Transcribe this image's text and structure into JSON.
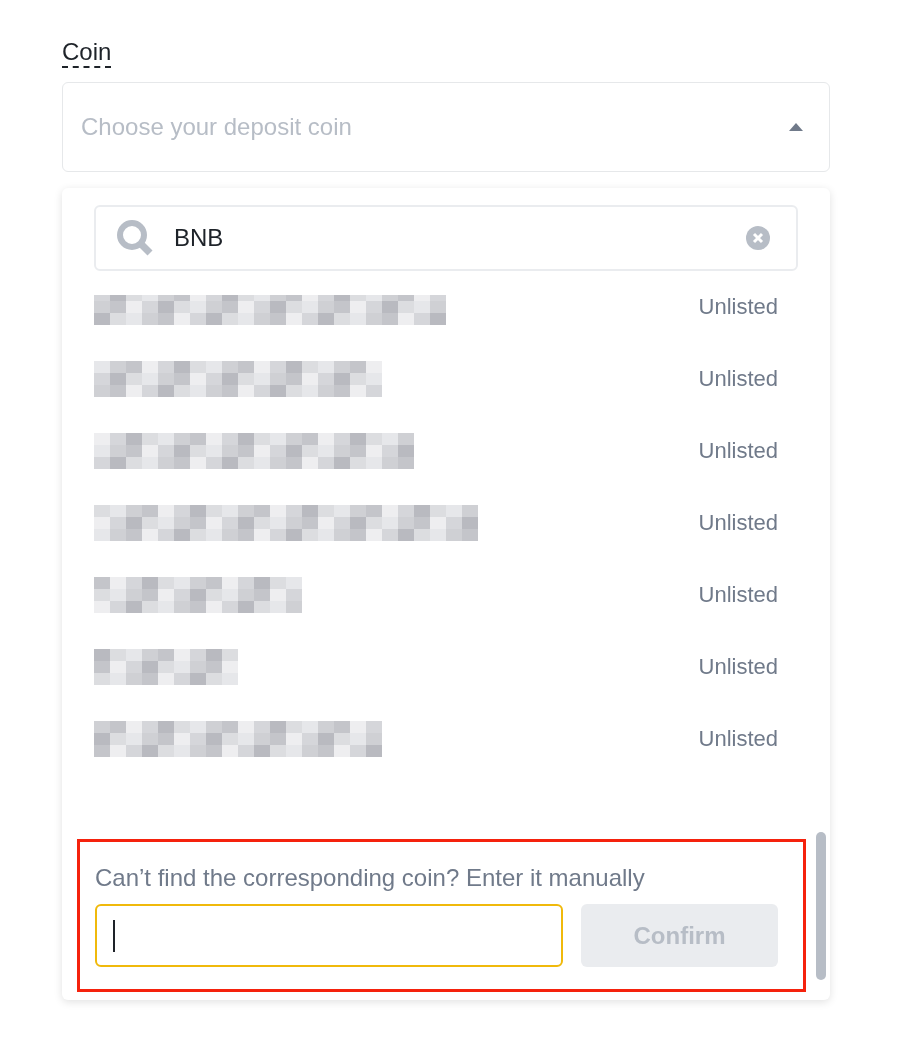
{
  "field_label": "Coin",
  "select": {
    "placeholder": "Choose your deposit coin",
    "expanded": true
  },
  "dropdown": {
    "search": {
      "value": "BNB"
    },
    "rows": [
      {
        "status": "Unlisted"
      },
      {
        "status": "Unlisted"
      },
      {
        "status": "Unlisted"
      },
      {
        "status": "Unlisted"
      },
      {
        "status": "Unlisted"
      },
      {
        "status": "Unlisted"
      },
      {
        "status": "Unlisted"
      }
    ],
    "manual": {
      "prompt": "Can’t find the corresponding coin? Enter it manually",
      "focused": true,
      "button": {
        "label": "Confirm",
        "disabled": true
      }
    }
  }
}
